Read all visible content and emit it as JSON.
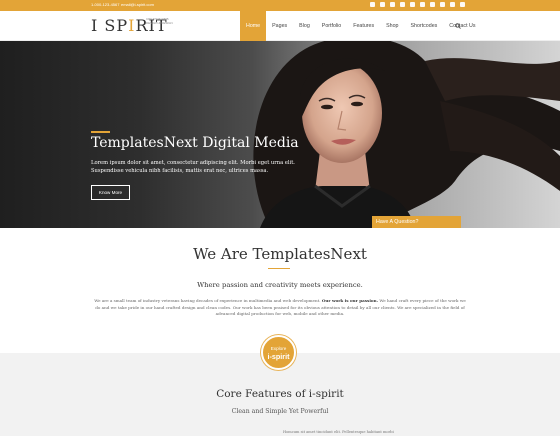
{
  "topbar": {
    "phone": "1-000-123-4567",
    "email": "email@i-spirit.com",
    "social_icons": [
      "twitter-icon",
      "facebook-icon",
      "skype-icon",
      "google-plus-icon",
      "linkedin-icon",
      "dribbble-icon",
      "youtube-icon",
      "vimeo-icon",
      "pinterest-icon",
      "instagram-icon"
    ]
  },
  "header": {
    "logo_text_left": "I SP",
    "logo_text_accent": "I",
    "logo_text_right": "RIT",
    "tagline": "CREATIVE WEB DESIGN & DESIGN",
    "nav": [
      "Home",
      "Pages",
      "Blog",
      "Portfolio",
      "Features",
      "Shop",
      "Shortcodes",
      "Contact Us"
    ],
    "active_nav": "Home"
  },
  "hero": {
    "title": "TemplatesNext Digital Media",
    "text_line1": "Lorem ipsum dolor sit amet, consectetur adipiscing elit. Morbi eget urna elit.",
    "text_line2": "Suspendisse vehicula nibh facilisis, mattis erat nec, ultrices massa.",
    "button_label": "Know More",
    "question_label": "Have A Question?"
  },
  "about": {
    "title": "We Are TemplatesNext",
    "subtitle": "Where passion and creativity meets experience.",
    "text_before": "We are a small team of industry veterans having decades of experience in multimedia and web development.",
    "text_bold": "Our work is our passion.",
    "text_after": "We hand craft every piece of the work we do and we take pride in our hand crafted design and clean codes. Our work has been praised for its obvious attention to detail by all our clients. We are specialized in the field of advanced digital production for web, mobile and other media."
  },
  "explore": {
    "top": "Explore",
    "main": "i-spirit"
  },
  "features": {
    "title": "Core Features of i-spirit",
    "subtitle": "Clean and Simple Yet Powerful",
    "snippet": "Homcum sit amet tincidunt elit. Pellentesque habitant morbi"
  },
  "colors": {
    "accent": "#e3a437",
    "text_dark": "#333333",
    "features_bg": "#f2f2f2"
  }
}
